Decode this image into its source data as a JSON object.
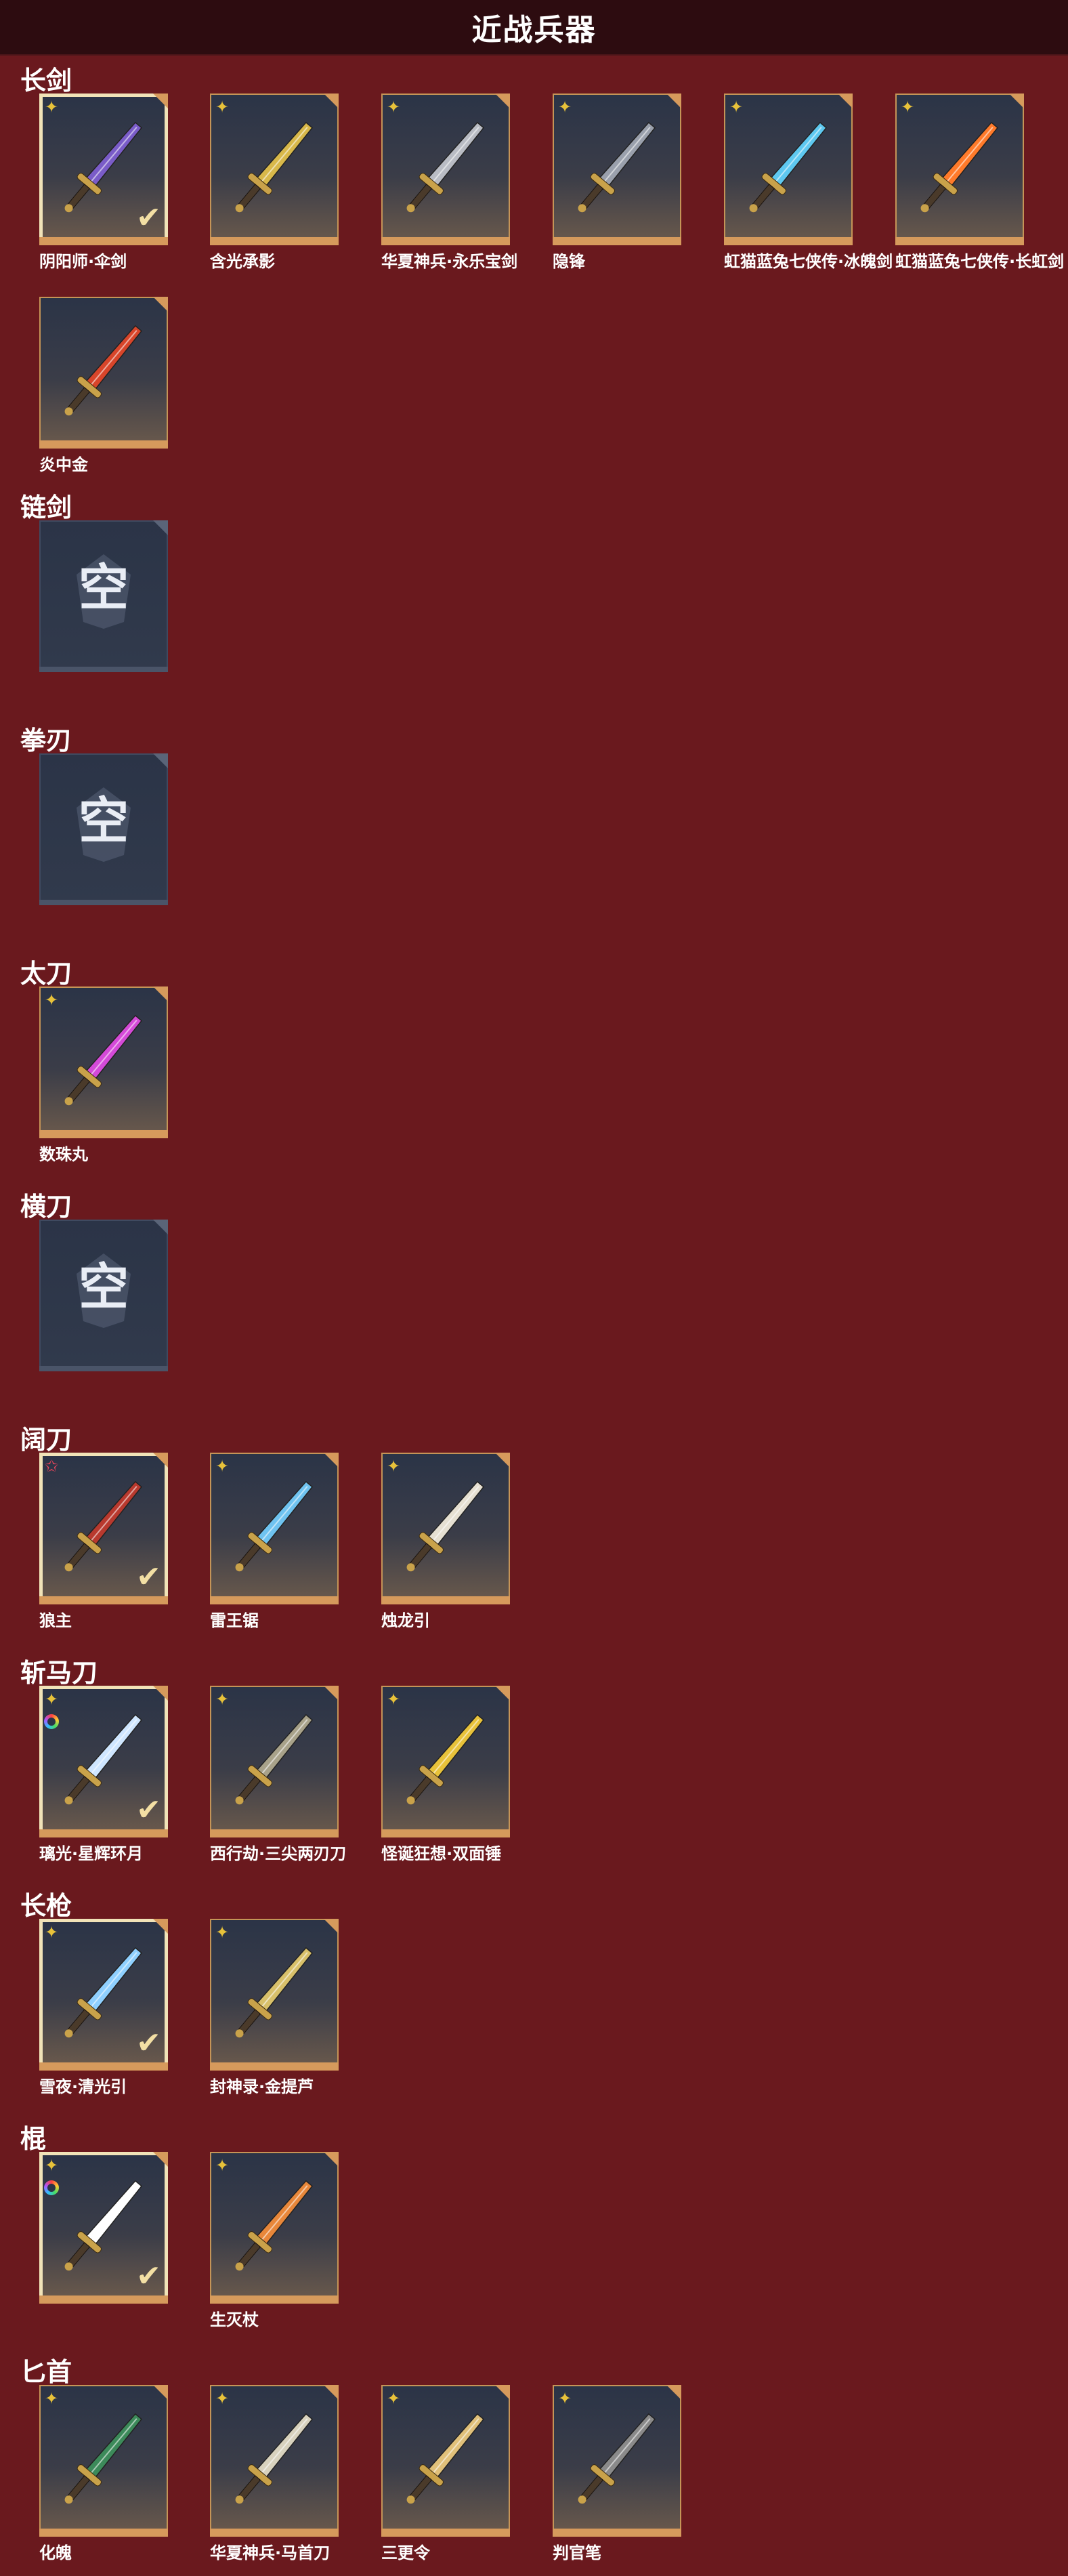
{
  "header": {
    "title": "近战兵器"
  },
  "empty_label": "空",
  "icons": {
    "rank_gold": "four-point-star-icon",
    "rank_red": "red-star-icon",
    "rainbow": "rainbow-ring-icon",
    "check": "check-mark-icon"
  },
  "colors": {
    "background": "#6a191e",
    "header": "#2d0c10",
    "card_border": "#c59457",
    "selected_border": "#f1e3b8"
  },
  "sections": [
    {
      "title": "长剑",
      "items": [
        {
          "name": "阴阳师·伞剑",
          "rank": "gold",
          "selected": true
        },
        {
          "name": "含光承影",
          "rank": "gold",
          "selected": false
        },
        {
          "name": "华夏神兵·永乐宝剑",
          "rank": "gold",
          "selected": false
        },
        {
          "name": "隐锋",
          "rank": "gold",
          "selected": false
        },
        {
          "name": "虹猫蓝兔七侠传·冰魄剑",
          "rank": "gold",
          "selected": false
        },
        {
          "name": "虹猫蓝兔七侠传·长虹剑",
          "rank": "gold",
          "selected": false
        },
        {
          "name": "炎中金",
          "rank": "none",
          "selected": false
        }
      ]
    },
    {
      "title": "链剑",
      "items": []
    },
    {
      "title": "拳刃",
      "items": []
    },
    {
      "title": "太刀",
      "items": [
        {
          "name": "数珠丸",
          "rank": "gold",
          "selected": false
        }
      ]
    },
    {
      "title": "横刀",
      "items": []
    },
    {
      "title": "阔刀",
      "items": [
        {
          "name": "狼主",
          "rank": "red",
          "selected": true
        },
        {
          "name": "雷王锯",
          "rank": "gold",
          "selected": false
        },
        {
          "name": "烛龙引",
          "rank": "gold",
          "selected": false
        }
      ]
    },
    {
      "title": "斩马刀",
      "items": [
        {
          "name": "璃光·星辉环月",
          "rank": "gold",
          "rainbow": true,
          "selected": true
        },
        {
          "name": "西行劫·三尖两刃刀",
          "rank": "gold",
          "selected": false
        },
        {
          "name": "怪诞狂想·双面锤",
          "rank": "gold",
          "selected": false
        }
      ]
    },
    {
      "title": "长枪",
      "items": [
        {
          "name": "雪夜·清光引",
          "rank": "gold",
          "selected": true
        },
        {
          "name": "封神录·金提芦",
          "rank": "gold",
          "selected": false
        }
      ]
    },
    {
      "title": "棍",
      "items": [
        {
          "name": "",
          "rank": "gold",
          "rainbow": true,
          "selected": true
        },
        {
          "name": "生灭杖",
          "rank": "gold",
          "selected": false
        }
      ]
    },
    {
      "title": "匕首",
      "items": [
        {
          "name": "化魄",
          "rank": "gold",
          "selected": false
        },
        {
          "name": "华夏神兵·马首刀",
          "rank": "gold",
          "selected": false
        },
        {
          "name": "三更令",
          "rank": "gold",
          "selected": false
        },
        {
          "name": "判官笔",
          "rank": "gold",
          "selected": false
        }
      ]
    }
  ]
}
